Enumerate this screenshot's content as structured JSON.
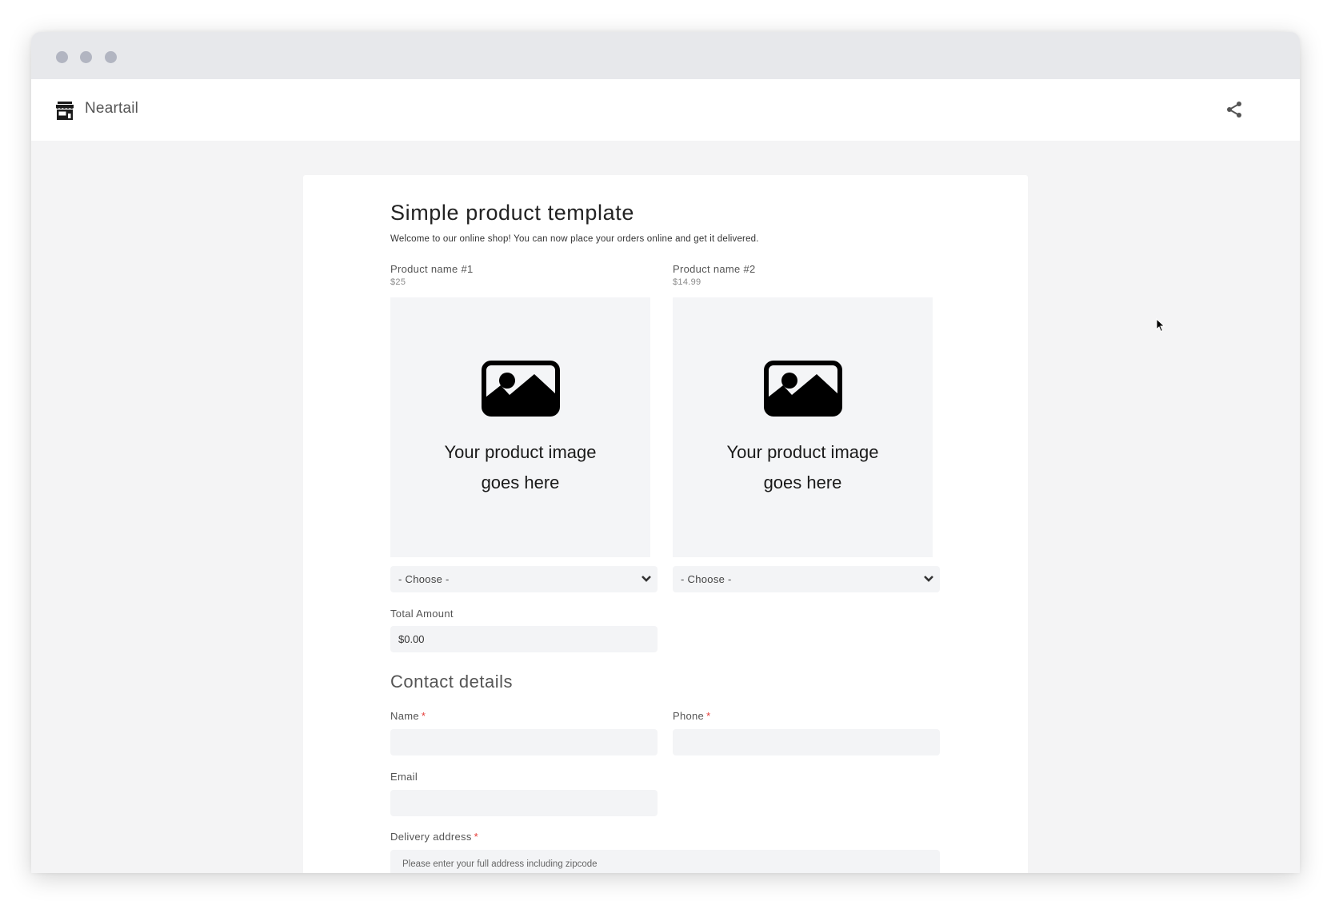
{
  "window": {
    "controls": [
      "close",
      "minimize",
      "maximize"
    ]
  },
  "appbar": {
    "brand": "Neartail",
    "logo_icon": "store-icon",
    "share_icon": "share-icon"
  },
  "form": {
    "title": "Simple product template",
    "description": "Welcome to our online shop! You can now place your orders online and get it delivered.",
    "products": [
      {
        "name": "Product name #1",
        "price": "$25",
        "image_placeholder_line1": "Your product image",
        "image_placeholder_line2": "goes here",
        "quantity_select": "- Choose -"
      },
      {
        "name": "Product name #2",
        "price": "$14.99",
        "image_placeholder_line1": "Your product image",
        "image_placeholder_line2": "goes here",
        "quantity_select": "- Choose -"
      }
    ],
    "total": {
      "label": "Total Amount",
      "value": "$0.00"
    },
    "contact_section": "Contact details",
    "fields": {
      "name": {
        "label": "Name",
        "required_mark": "*",
        "value": ""
      },
      "phone": {
        "label": "Phone",
        "required_mark": "*",
        "value": ""
      },
      "email": {
        "label": "Email",
        "value": ""
      },
      "address": {
        "label": "Delivery address",
        "required_mark": "*",
        "placeholder": "Please enter your full address including zipcode"
      }
    }
  },
  "colors": {
    "required": "#e53935",
    "field_bg": "#f3f4f6",
    "page_bg": "#f4f4f5",
    "titlebar_bg": "#e7e8eb"
  }
}
